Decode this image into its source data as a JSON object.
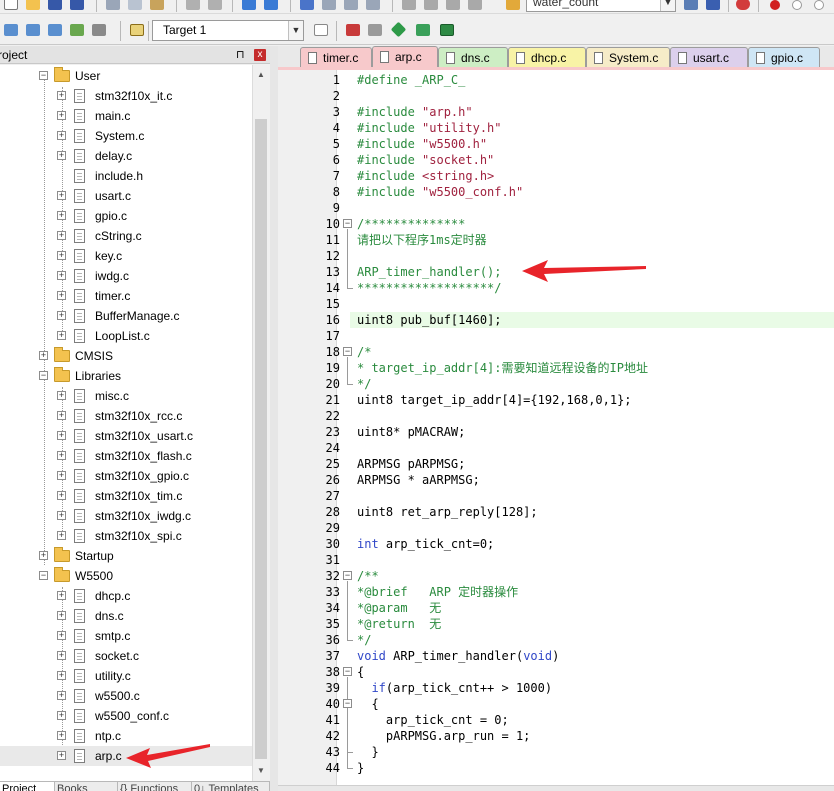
{
  "toolbar": {
    "target_name": "Target 1",
    "search_combo_value": "water_count"
  },
  "project_panel": {
    "title": "roject",
    "pin_glyph": "⊓",
    "close_glyph": "x",
    "tabs": [
      {
        "label": "Project"
      },
      {
        "label": "Books"
      },
      {
        "label": "{} Functions"
      },
      {
        "label": "0↓ Templates"
      }
    ],
    "tree": [
      {
        "label": "User",
        "type": "folder",
        "level": 1,
        "expander": "−"
      },
      {
        "label": "stm32f10x_it.c",
        "type": "file",
        "level": 2,
        "expander": "+"
      },
      {
        "label": "main.c",
        "type": "file",
        "level": 2,
        "expander": "+"
      },
      {
        "label": "System.c",
        "type": "file",
        "level": 2,
        "expander": "+"
      },
      {
        "label": "delay.c",
        "type": "file",
        "level": 2,
        "expander": "+"
      },
      {
        "label": "include.h",
        "type": "file",
        "level": 2,
        "expander": ""
      },
      {
        "label": "usart.c",
        "type": "file",
        "level": 2,
        "expander": "+"
      },
      {
        "label": "gpio.c",
        "type": "file",
        "level": 2,
        "expander": "+"
      },
      {
        "label": "cString.c",
        "type": "file",
        "level": 2,
        "expander": "+"
      },
      {
        "label": "key.c",
        "type": "file",
        "level": 2,
        "expander": "+"
      },
      {
        "label": "iwdg.c",
        "type": "file",
        "level": 2,
        "expander": "+"
      },
      {
        "label": "timer.c",
        "type": "file",
        "level": 2,
        "expander": "+"
      },
      {
        "label": "BufferManage.c",
        "type": "file",
        "level": 2,
        "expander": "+"
      },
      {
        "label": "LoopList.c",
        "type": "file",
        "level": 2,
        "expander": "+"
      },
      {
        "label": "CMSIS",
        "type": "folder",
        "level": 1,
        "expander": "+"
      },
      {
        "label": "Libraries",
        "type": "folder",
        "level": 1,
        "expander": "−"
      },
      {
        "label": "misc.c",
        "type": "file",
        "level": 2,
        "expander": "+"
      },
      {
        "label": "stm32f10x_rcc.c",
        "type": "file",
        "level": 2,
        "expander": "+"
      },
      {
        "label": "stm32f10x_usart.c",
        "type": "file",
        "level": 2,
        "expander": "+"
      },
      {
        "label": "stm32f10x_flash.c",
        "type": "file",
        "level": 2,
        "expander": "+"
      },
      {
        "label": "stm32f10x_gpio.c",
        "type": "file",
        "level": 2,
        "expander": "+"
      },
      {
        "label": "stm32f10x_tim.c",
        "type": "file",
        "level": 2,
        "expander": "+"
      },
      {
        "label": "stm32f10x_iwdg.c",
        "type": "file",
        "level": 2,
        "expander": "+"
      },
      {
        "label": "stm32f10x_spi.c",
        "type": "file",
        "level": 2,
        "expander": "+"
      },
      {
        "label": "Startup",
        "type": "folder",
        "level": 1,
        "expander": "+"
      },
      {
        "label": "W5500",
        "type": "folder",
        "level": 1,
        "expander": "−"
      },
      {
        "label": "dhcp.c",
        "type": "file",
        "level": 2,
        "expander": "+"
      },
      {
        "label": "dns.c",
        "type": "file",
        "level": 2,
        "expander": "+"
      },
      {
        "label": "smtp.c",
        "type": "file",
        "level": 2,
        "expander": "+"
      },
      {
        "label": "socket.c",
        "type": "file",
        "level": 2,
        "expander": "+"
      },
      {
        "label": "utility.c",
        "type": "file",
        "level": 2,
        "expander": "+"
      },
      {
        "label": "w5500.c",
        "type": "file",
        "level": 2,
        "expander": "+"
      },
      {
        "label": "w5500_conf.c",
        "type": "file",
        "level": 2,
        "expander": "+"
      },
      {
        "label": "ntp.c",
        "type": "file",
        "level": 2,
        "expander": "+"
      },
      {
        "label": "arp.c",
        "type": "file",
        "level": 2,
        "expander": "+",
        "selected": true
      }
    ]
  },
  "editor": {
    "tabs": [
      {
        "label": "timer.c",
        "color": "#f7c9cb"
      },
      {
        "label": "arp.c",
        "color": "#f7c9cb",
        "active": true
      },
      {
        "label": "dns.c",
        "color": "#cdeec4"
      },
      {
        "label": "dhcp.c",
        "color": "#f8f3a6"
      },
      {
        "label": "System.c",
        "color": "#f6ecc8"
      },
      {
        "label": "usart.c",
        "color": "#dcd0ec"
      },
      {
        "label": "gpio.c",
        "color": "#cfe6f5"
      }
    ],
    "highlighted_line": 16,
    "lines": [
      [
        {
          "t": "#define _ARP_C_",
          "c": "pp"
        }
      ],
      [],
      [
        {
          "t": "#include ",
          "c": "pp"
        },
        {
          "t": "\"arp.h\"",
          "c": "str"
        }
      ],
      [
        {
          "t": "#include ",
          "c": "pp"
        },
        {
          "t": "\"utility.h\"",
          "c": "str"
        }
      ],
      [
        {
          "t": "#include ",
          "c": "pp"
        },
        {
          "t": "\"w5500.h\"",
          "c": "str"
        }
      ],
      [
        {
          "t": "#include ",
          "c": "pp"
        },
        {
          "t": "\"socket.h\"",
          "c": "str"
        }
      ],
      [
        {
          "t": "#include ",
          "c": "pp"
        },
        {
          "t": "<string.h>",
          "c": "str"
        }
      ],
      [
        {
          "t": "#include ",
          "c": "pp"
        },
        {
          "t": "\"w5500_conf.h\"",
          "c": "str"
        }
      ],
      [],
      [
        {
          "t": "/**************",
          "c": "cm"
        }
      ],
      [
        {
          "t": "请把以下程序1ms定时器",
          "c": "cm"
        }
      ],
      [],
      [
        {
          "t": "ARP_timer_handler();",
          "c": "cm"
        }
      ],
      [
        {
          "t": "*******************/",
          "c": "cm"
        }
      ],
      [],
      [
        {
          "t": "uint8 pub_buf[",
          "c": ""
        },
        {
          "t": "1460",
          "c": ""
        },
        {
          "t": "];",
          "c": ""
        }
      ],
      [],
      [
        {
          "t": "/*",
          "c": "cm"
        }
      ],
      [
        {
          "t": "* target_ip_addr[4]:需要知道远程设备的IP地址",
          "c": "cm"
        }
      ],
      [
        {
          "t": "*/",
          "c": "cm"
        }
      ],
      [
        {
          "t": "uint8 target_ip_addr[4]={192,168,0,1};",
          "c": ""
        }
      ],
      [],
      [
        {
          "t": "uint8* pMACRAW;",
          "c": ""
        }
      ],
      [],
      [
        {
          "t": "ARPMSG pARPMSG;",
          "c": ""
        }
      ],
      [
        {
          "t": "ARPMSG * aARPMSG;",
          "c": ""
        }
      ],
      [],
      [
        {
          "t": "uint8 ret_arp_reply[128];",
          "c": ""
        }
      ],
      [],
      [
        {
          "t": "int",
          "c": "kw"
        },
        {
          "t": " arp_tick_cnt=0;",
          "c": ""
        }
      ],
      [],
      [
        {
          "t": "/**",
          "c": "cm"
        }
      ],
      [
        {
          "t": "*@brief   ARP 定时器操作",
          "c": "cm"
        }
      ],
      [
        {
          "t": "*@param   无",
          "c": "cm"
        }
      ],
      [
        {
          "t": "*@return  无",
          "c": "cm"
        }
      ],
      [
        {
          "t": "*/",
          "c": "cm"
        }
      ],
      [
        {
          "t": "void",
          "c": "kw"
        },
        {
          "t": " ARP_timer_handler(",
          "c": ""
        },
        {
          "t": "void",
          "c": "kw"
        },
        {
          "t": ")",
          "c": ""
        }
      ],
      [
        {
          "t": "{",
          "c": ""
        }
      ],
      [
        {
          "t": "  ",
          "c": ""
        },
        {
          "t": "if",
          "c": "kw"
        },
        {
          "t": "(arp_tick_cnt++ > 1000)",
          "c": ""
        }
      ],
      [
        {
          "t": "  {",
          "c": ""
        }
      ],
      [
        {
          "t": "    arp_tick_cnt = 0;",
          "c": ""
        }
      ],
      [
        {
          "t": "    pARPMSG.arp_run = 1;",
          "c": ""
        }
      ],
      [
        {
          "t": "  }",
          "c": ""
        }
      ],
      [
        {
          "t": "}",
          "c": ""
        }
      ]
    ]
  }
}
